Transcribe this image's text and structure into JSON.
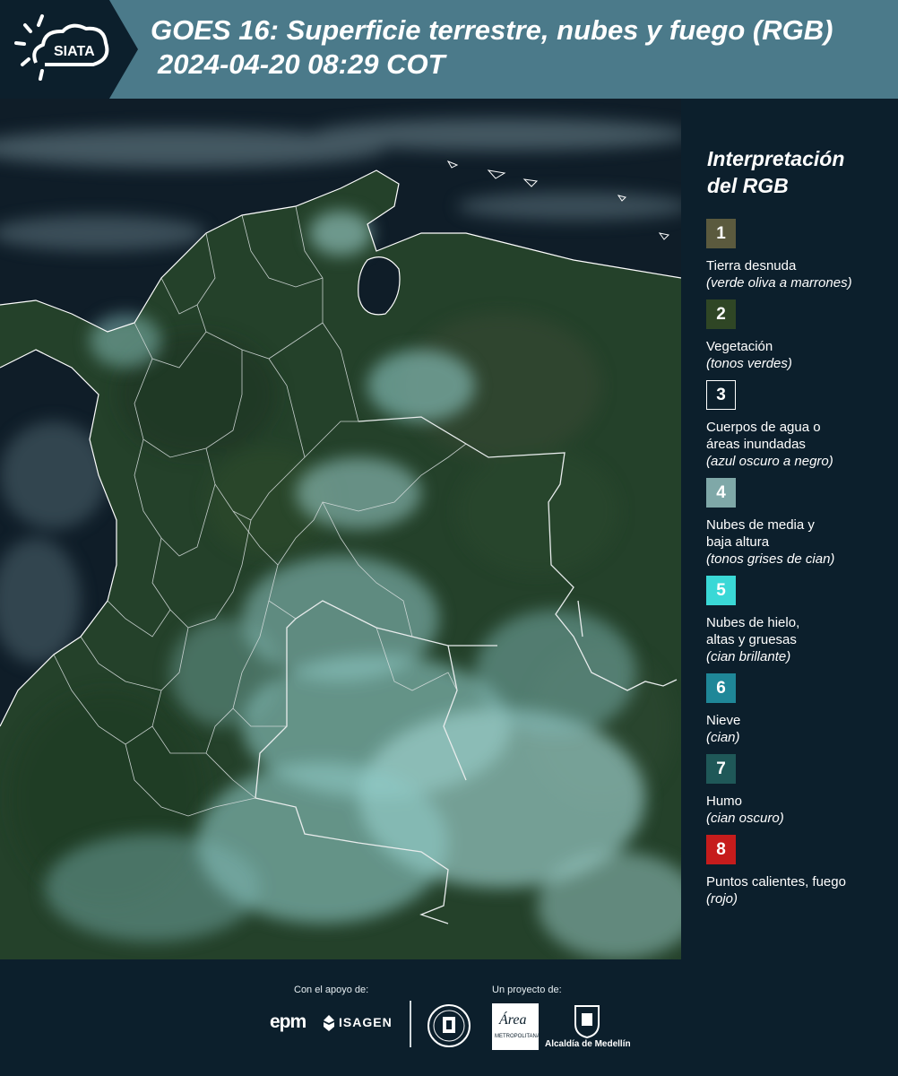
{
  "header": {
    "logo_text": "SIATA",
    "title_line1": "GOES 16: Superficie terrestre, nubes y fuego (RGB)",
    "title_line2": "2024-04-20 08:29 COT",
    "background_color": "#4b7a8a"
  },
  "map": {
    "description_icon": "satellite-rgb-composite-map",
    "land_color": "#24412a",
    "water_color": "#0f1d28",
    "cloud_color": "#8fc9c6"
  },
  "legend": {
    "title_line1": "Interpretación",
    "title_line2": "del RGB",
    "items": [
      {
        "number": "1",
        "label": "Tierra desnuda",
        "sub": "(verde oliva a marrones)",
        "color": "#5b5a3e"
      },
      {
        "number": "2",
        "label": "Vegetación",
        "sub": "(tonos verdes)",
        "color": "#2f4625"
      },
      {
        "number": "3",
        "label": "Cuerpos de agua o áreas inundadas",
        "sub": "(azul oscuro a negro)",
        "color": "#0c1f2c"
      },
      {
        "number": "4",
        "label": "Nubes de media y baja altura",
        "sub": "(tonos grises de cian)",
        "color": "#7fa8a8"
      },
      {
        "number": "5",
        "label": "Nubes de hielo, altas y gruesas",
        "sub": "(cian brillante)",
        "color": "#3ad8d6"
      },
      {
        "number": "6",
        "label": "Nieve",
        "sub": "(cian)",
        "color": "#1f8798"
      },
      {
        "number": "7",
        "label": "Humo",
        "sub": "(cian oscuro)",
        "color": "#1f5858"
      },
      {
        "number": "8",
        "label": "Puntos calientes, fuego",
        "sub": "(rojo)",
        "color": "#c61c1c"
      }
    ]
  },
  "footer": {
    "support_caption": "Con el apoyo de:",
    "project_caption": "Un proyecto de:",
    "epm_label": "epm",
    "isagen_label": "ISAGEN",
    "area_label": "Área",
    "area_sub": "METROPOLITANA",
    "alcaldia_label": "Alcaldía de Medellín"
  }
}
